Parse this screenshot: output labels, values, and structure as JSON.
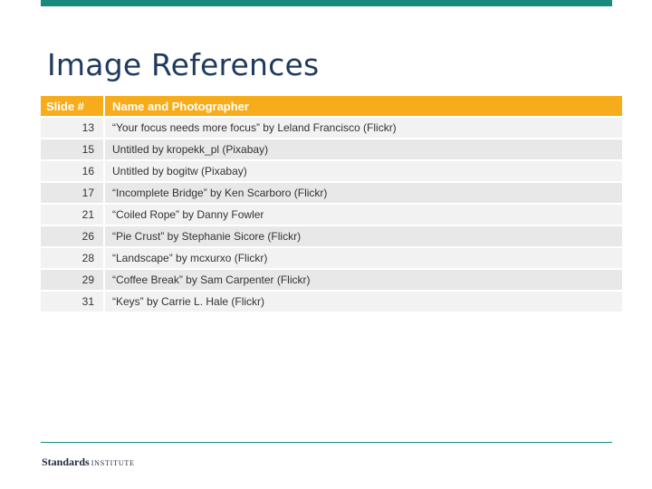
{
  "slide": {
    "title": "Image References"
  },
  "table": {
    "headers": {
      "slide": "Slide #",
      "name": "Name and Photographer"
    },
    "rows": [
      {
        "slide": "13",
        "name": "“Your focus needs more focus” by Leland Francisco (Flickr)"
      },
      {
        "slide": "15",
        "name": "Untitled by kropekk_pl (Pixabay)"
      },
      {
        "slide": "16",
        "name": "Untitled by bogitw (Pixabay)"
      },
      {
        "slide": "17",
        "name": "“Incomplete Bridge” by Ken Scarboro (Flickr)"
      },
      {
        "slide": "21",
        "name": "“Coiled Rope” by Danny Fowler"
      },
      {
        "slide": "26",
        "name": "“Pie Crust” by Stephanie Sicore (Flickr)"
      },
      {
        "slide": "28",
        "name": "“Landscape” by mcxurxo (Flickr)"
      },
      {
        "slide": "29",
        "name": "“Coffee Break” by Sam Carpenter (Flickr)"
      },
      {
        "slide": "31",
        "name": "“Keys” by Carrie L. Hale (Flickr)"
      }
    ]
  },
  "footer": {
    "logo_main": "Standards",
    "logo_sub": "INSTITUTE"
  },
  "colors": {
    "accent": "#1a8a7c",
    "header": "#f7ad1b",
    "title": "#1f3a5f"
  }
}
